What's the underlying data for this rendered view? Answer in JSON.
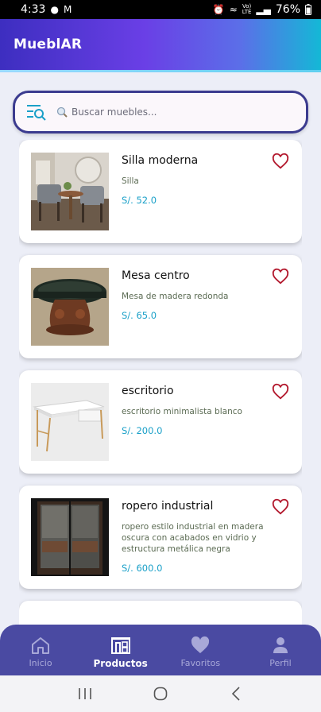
{
  "status_bar": {
    "time": "4:33",
    "vol_label": "Vo)",
    "lte_label": "LTE",
    "battery": "76%"
  },
  "app_bar": {
    "title": "MueblAR"
  },
  "search": {
    "placeholder": "Buscar muebles..."
  },
  "products": [
    {
      "name": "Silla moderna",
      "description": "Silla",
      "price": "S/. 52.0",
      "image": "chairs-image"
    },
    {
      "name": "Mesa centro",
      "description": "Mesa de madera redonda",
      "price": "S/. 65.0",
      "image": "round-table-image"
    },
    {
      "name": "escritorio",
      "description": "escritorio minimalista blanco",
      "price": "S/. 200.0",
      "image": "desk-image"
    },
    {
      "name": "ropero industrial",
      "description": "ropero  estilo industrial  en madera oscura con acabados en vidrio  y estructura metálica negra",
      "price": "S/. 600.0",
      "image": "wardrobe-image"
    }
  ],
  "bottom_nav": {
    "items": [
      {
        "label": "Inicio",
        "icon": "home-icon",
        "active": false
      },
      {
        "label": "Productos",
        "icon": "store-icon",
        "active": true
      },
      {
        "label": "Favoritos",
        "icon": "heart-icon",
        "active": false
      },
      {
        "label": "Perfil",
        "icon": "person-icon",
        "active": false
      }
    ]
  },
  "colors": {
    "accent": "#1aa0c8",
    "nav_bg": "#4a4aa2",
    "heart": "#b3192e",
    "search_border": "#3b3b8f"
  }
}
